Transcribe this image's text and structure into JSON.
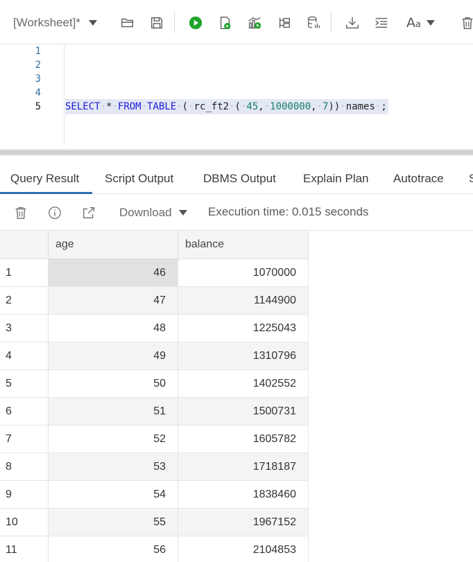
{
  "toolbar": {
    "worksheet_label": "[Worksheet]*",
    "icons": [
      "folder-open-icon",
      "save-icon",
      "run-statement-icon",
      "run-script-icon",
      "explain-plan-icon",
      "autotrace-icon",
      "sql-history-icon",
      "download-icon",
      "format-icon",
      "font-size-icon",
      "delete-icon"
    ],
    "font_label": "A",
    "font_label_small": "a",
    "accent": "#21a52c"
  },
  "editor": {
    "line_numbers": [
      "1",
      "2",
      "3",
      "4",
      "5"
    ],
    "sql": {
      "t1": "SELECT",
      "t2": "*",
      "t3": "FROM",
      "t4": "TABLE",
      "t5": "(",
      "t6": "rc_ft2",
      "t7": "(",
      "t8": "45",
      "t9": ",",
      "t10": "1000000",
      "t11": ",",
      "t12": "7",
      "t13": "))",
      "t14": "names",
      "t15": ";"
    }
  },
  "tabs": [
    {
      "label": "Query Result"
    },
    {
      "label": "Script Output"
    },
    {
      "label": "DBMS Output"
    },
    {
      "label": "Explain Plan"
    },
    {
      "label": "Autotrace"
    },
    {
      "label": "S"
    }
  ],
  "result_toolbar": {
    "download_label": "Download",
    "execution_time": "Execution time: 0.015 seconds"
  },
  "grid": {
    "columns": [
      "age",
      "balance"
    ],
    "rows": [
      {
        "n": "1",
        "age": "46",
        "balance": "1070000"
      },
      {
        "n": "2",
        "age": "47",
        "balance": "1144900"
      },
      {
        "n": "3",
        "age": "48",
        "balance": "1225043"
      },
      {
        "n": "4",
        "age": "49",
        "balance": "1310796"
      },
      {
        "n": "5",
        "age": "50",
        "balance": "1402552"
      },
      {
        "n": "6",
        "age": "51",
        "balance": "1500731"
      },
      {
        "n": "7",
        "age": "52",
        "balance": "1605782"
      },
      {
        "n": "8",
        "age": "53",
        "balance": "1718187"
      },
      {
        "n": "9",
        "age": "54",
        "balance": "1838460"
      },
      {
        "n": "10",
        "age": "55",
        "balance": "1967152"
      },
      {
        "n": "11",
        "age": "56",
        "balance": "2104853"
      }
    ]
  }
}
